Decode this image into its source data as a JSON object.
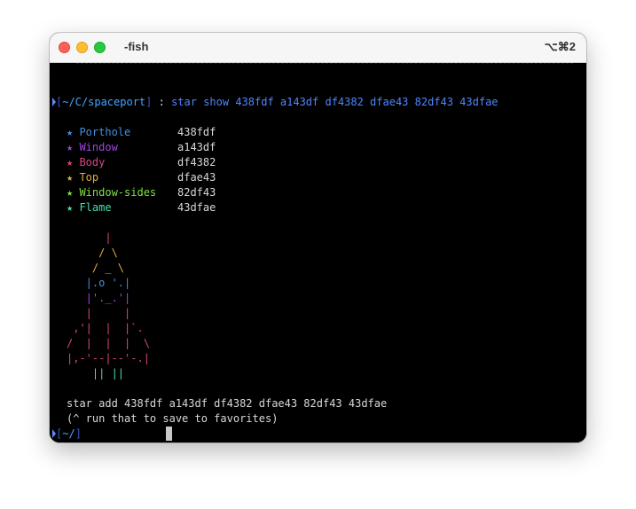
{
  "window": {
    "title": "-fish",
    "shortcut": "⌥⌘2"
  },
  "prompt": {
    "open_bracket": "[",
    "cwd": "~/C/spaceport",
    "close_bracket": "]",
    "separator": " : ",
    "command": "star show 438fdf a143df df4382 dfae43 82df43 43dfae"
  },
  "palette": [
    {
      "name": "★ Porthole",
      "hex": "438fdf",
      "color": "#438fdf"
    },
    {
      "name": "★ Window",
      "hex": "a143df",
      "color": "#a143df"
    },
    {
      "name": "★ Body",
      "hex": "df4382",
      "color": "#df4382"
    },
    {
      "name": "★ Top",
      "hex": "dfae43",
      "color": "#dfae43"
    },
    {
      "name": "★ Window-sides",
      "hex": "82df43",
      "color": "#82df43"
    },
    {
      "name": "★ Flame",
      "hex": "43dfae",
      "color": "#43dfae"
    }
  ],
  "rocket": [
    {
      "text": "      |",
      "color": "#df4382"
    },
    {
      "text": "     / \\",
      "color": "#dfae43"
    },
    {
      "text": "    / _ \\",
      "color": "#dfae43"
    },
    {
      "text": "   |.o '.|",
      "color": "#438fdf"
    },
    {
      "text": "   |'._.'|",
      "color": "#a143df"
    },
    {
      "text": "   |     |",
      "color": "#df4382"
    },
    {
      "text": " ,'|  |  |`.",
      "color": "#df4382"
    },
    {
      "text": "/  |  |  |  \\",
      "color": "#df4382"
    },
    {
      "text": "|,-'--|--'-.|",
      "color": "#df4382"
    },
    {
      "text": "    || ||",
      "color": "#43dfae"
    }
  ],
  "output": {
    "add_command": "star add 438fdf a143df df4382 dfae43 82df43 43dfae",
    "hint": "(^ run that to save to favorites)"
  },
  "prompt2": {
    "open_bracket": "[",
    "cwd": "~/",
    "close_bracket": "]"
  }
}
